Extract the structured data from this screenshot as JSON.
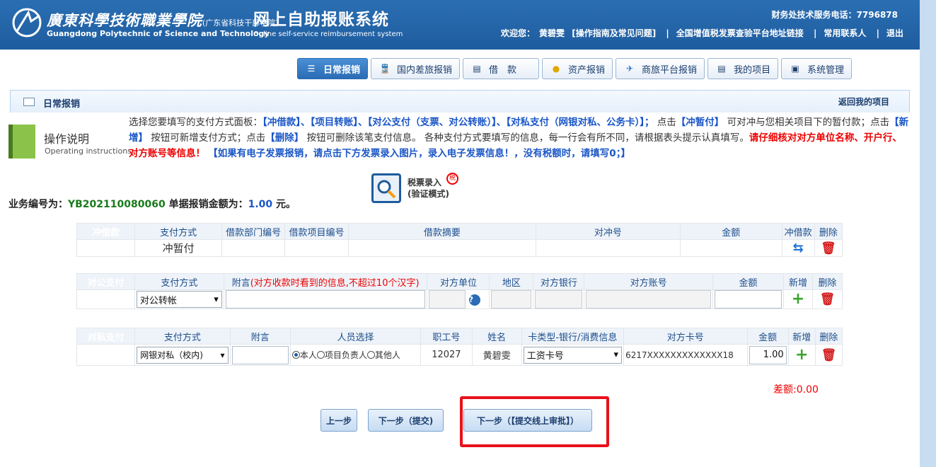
{
  "header": {
    "logo_cn": "廣東科學技術職業學院",
    "logo_cn_sub": "(广东省科技干部学院)",
    "logo_en": "Guangdong Polytechnic of Science and Technology",
    "system_title": "网上自助报账系统",
    "system_subtitle": "Online self-service reimbursement system",
    "hotline": "财务处技术服务电话：7796878",
    "welcome": "欢迎您：",
    "user_name": "黄碧雯",
    "nav": [
      "[操作指南及常见问题]",
      "全国增值税发票查验平台地址链接",
      "常用联系人",
      "退出"
    ]
  },
  "tabs": [
    {
      "label": "日常报销",
      "icon": "list-icon",
      "glyph": "☰",
      "active": true
    },
    {
      "label": "国内差旅报销",
      "icon": "train-icon",
      "glyph": "🚆",
      "active": false
    },
    {
      "label": "借　款",
      "icon": "loan-icon",
      "glyph": "▤",
      "active": false
    },
    {
      "label": "资产报销",
      "icon": "coins-icon",
      "glyph": "●",
      "active": false
    },
    {
      "label": "商旅平台报销",
      "icon": "plane-icon",
      "glyph": "✈",
      "active": false
    },
    {
      "label": "我的项目",
      "icon": "document-icon",
      "glyph": "▤",
      "active": false
    },
    {
      "label": "系统管理",
      "icon": "settings-icon",
      "glyph": "▣",
      "active": false
    }
  ],
  "section": {
    "title": "日常报销",
    "back_link": "返回我的项目"
  },
  "operations": {
    "title": "操作说明",
    "subtitle": "Operating instructions",
    "p1": "选择您要填写的支付方式面板：",
    "b1": "【冲借款】、【项目转账】、【对公支付（支票、对公转账）】、【对私支付（网银对私、公务卡）】；",
    "p2": "点击",
    "b2": "【冲暂付】",
    "p3": "可对冲与您相关项目下的暂付款；点击",
    "b3": "【新增】",
    "p4": "按钮可新增支付方式；点击",
    "b4": "【删除】",
    "p5": "按钮可删除该笔支付信息。 各种支付方式要填写的信息，每一行会有所不同，请根据表头提示认真填写。",
    "red": "请仔细核对对方单位名称、开户行、对方账号等信息！",
    "b5": "【如果有电子发票报销，请点击下方发票录入图片，录入电子发票信息！，没有税额时，请填写0；】"
  },
  "tax_entry": {
    "label": "税票录入",
    "mode": "(验证模式)",
    "badge": "税"
  },
  "business": {
    "id_label": "业务编号为：",
    "id": "YB202110080060",
    "amount_label": "单据报销金额为：",
    "amount": "1.00",
    "unit": "元。"
  },
  "loan_table": {
    "label": "冲借款",
    "headers": [
      "支付方式",
      "借款部门编号",
      "借款项目编号",
      "借款摘要",
      "对冲号",
      "金额",
      "冲借款",
      "删除"
    ],
    "row": {
      "method": "冲暂付"
    }
  },
  "public_table": {
    "label": "对公支付",
    "headers": [
      "支付方式",
      "附言",
      "(对方收款时看到的信息,不超过10个汉字)",
      "对方单位",
      "地区",
      "对方银行",
      "对方账号",
      "金额",
      "新增",
      "删除"
    ],
    "row": {
      "method": "对公转帐"
    }
  },
  "private_table": {
    "label": "对私支付",
    "headers": [
      "支付方式",
      "附言",
      "人员选择",
      "职工号",
      "姓名",
      "卡类型-银行/消费信息",
      "对方卡号",
      "金额",
      "新增",
      "删除"
    ],
    "row": {
      "method": "网银对私（校内)",
      "radios": [
        "本人",
        "项目负责人",
        "其他人"
      ],
      "employee_id": "12027",
      "name": "黄碧雯",
      "card_type": "工资卡号",
      "card_number": "6217XXXXXXXXXXXXX18",
      "amount": "1.00"
    }
  },
  "difference": "差额:0.00",
  "buttons": {
    "prev": "上一步",
    "next_submit": "下一步（提交)",
    "next_online": "下一步（【提交线上审批】）"
  }
}
